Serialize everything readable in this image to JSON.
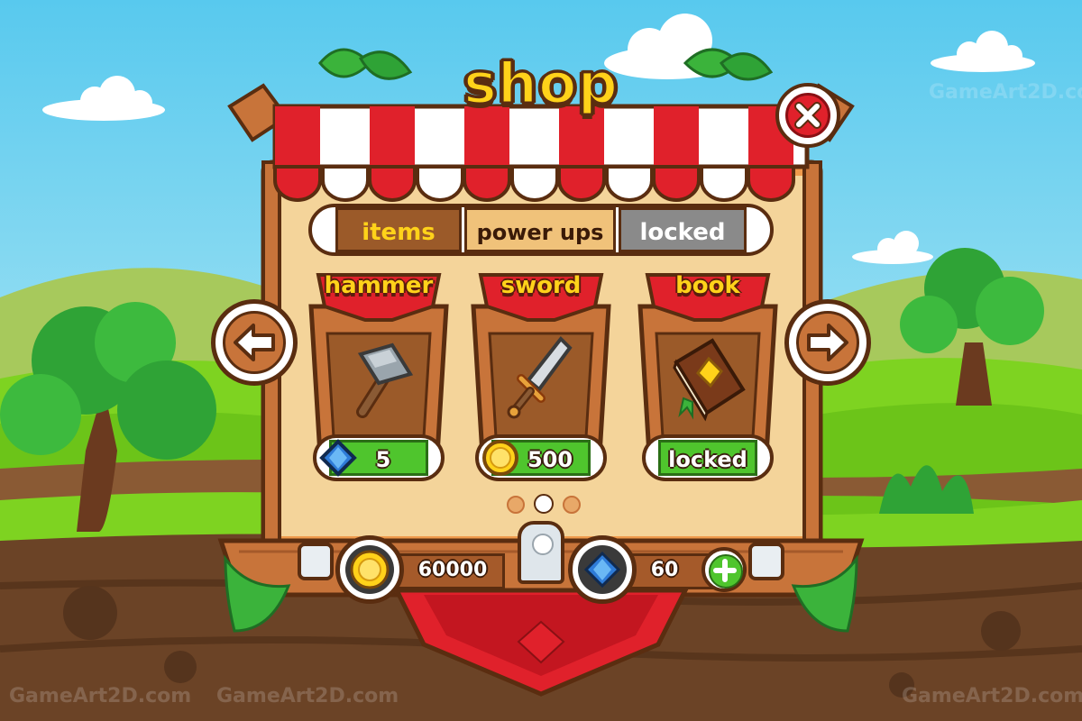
{
  "shop": {
    "title": "shop",
    "tabs": [
      {
        "label": "items"
      },
      {
        "label": "power ups"
      },
      {
        "label": "locked"
      }
    ],
    "products": [
      {
        "name": "hammer",
        "price": "5",
        "currency": "gem-icon"
      },
      {
        "name": "sword",
        "price": "500",
        "currency": "coin-icon"
      },
      {
        "name": "book",
        "price": "locked",
        "currency": "lock-icon"
      }
    ],
    "resources": {
      "coins": "60000",
      "gems": "60"
    }
  },
  "watermark": "GameArt2D.com",
  "colors": {
    "title": "#ffd21a",
    "wood": "#c8743a",
    "price_bar": "#4fc52d",
    "awning_red": "#e0212b"
  }
}
